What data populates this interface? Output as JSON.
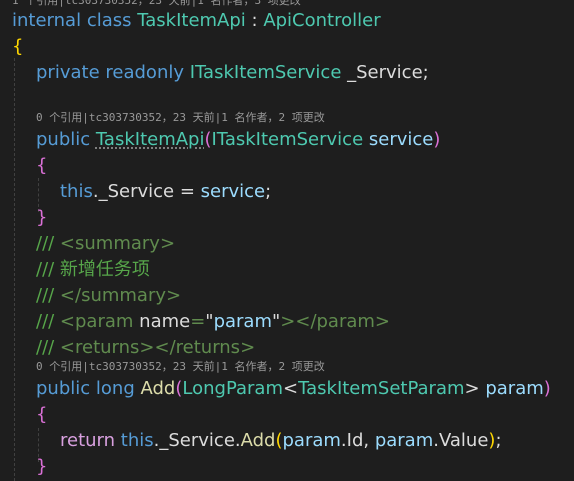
{
  "codelens": {
    "class": "1 个引用|tc303730352，23 天前|1 名作者，3 项更改",
    "ctor": "0 个引用|tc303730352，23 天前|1 名作者，2 项更改",
    "add": "0 个引用|tc303730352，23 天前|1 名作者，2 项更改"
  },
  "code": {
    "l1": {
      "kw1": "internal",
      "kw2": "class",
      "name": "TaskItemApi",
      "colon": " : ",
      "base": "ApiController"
    },
    "l2": {
      "brace": "{"
    },
    "l3": {
      "kw1": "private",
      "kw2": "readonly",
      "type": "ITaskItemService",
      "field": "_Service;"
    },
    "l4": {
      "kw": "public",
      "name": "TaskItemApi",
      "open": "(",
      "type": "ITaskItemService",
      "param": "service",
      "close": ")"
    },
    "l5": {
      "brace": "{"
    },
    "l6": {
      "this": "this",
      "rest": "._Service = ",
      "param": "service",
      "end": ";"
    },
    "l7": {
      "brace": "}"
    },
    "doc1": {
      "slashes": "/// ",
      "tag": "<summary>"
    },
    "doc2": {
      "slashes": "/// ",
      "text": "新增任务项"
    },
    "doc3": {
      "slashes": "/// ",
      "tag": "</summary>"
    },
    "doc4": {
      "slashes": "/// ",
      "tagOpen": "<param ",
      "attr": "name",
      "eq": "=",
      "q1": "\"",
      "val": "param",
      "q2": "\"",
      "tagClose": "></param>"
    },
    "doc5": {
      "slashes": "/// ",
      "tag": "<returns></returns>"
    },
    "l8": {
      "kw1": "public",
      "kw2": "long",
      "name": "Add",
      "open": "(",
      "type": "LongParam",
      "lt": "<",
      "targ": "TaskItemSetParam",
      "gt": ">",
      "param": "param",
      "close": ")"
    },
    "l9": {
      "brace": "{"
    },
    "l10": {
      "ret": "return",
      "this": "this",
      "mid": "._Service.",
      "method": "Add",
      "open": "(",
      "a1": "param",
      "p1": ".Id, ",
      "a2": "param",
      "p2": ".Value",
      "close": ")",
      "end": ";"
    },
    "l11": {
      "brace": "}"
    }
  },
  "colors": {
    "background": "#1e1e1e",
    "keyword": "#569cd6",
    "control": "#d8a0df",
    "type": "#4ec9b0",
    "method": "#dcdcaa",
    "parameter": "#9cdcfe",
    "comment": "#57a64a",
    "bracket1": "#ffd700",
    "bracket2": "#da70d6"
  }
}
